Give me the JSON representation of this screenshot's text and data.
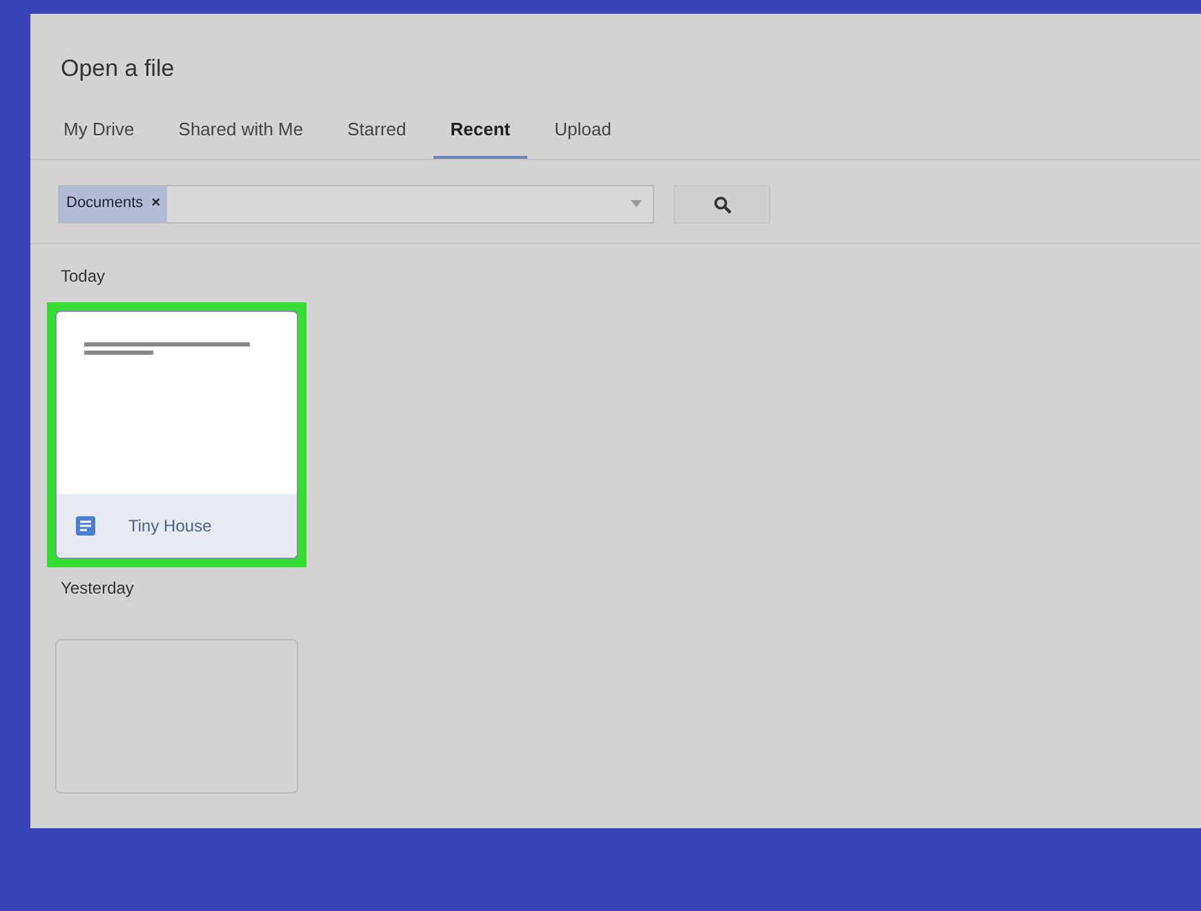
{
  "dialog": {
    "title": "Open a file"
  },
  "tabs": [
    {
      "label": "My Drive",
      "selected": false
    },
    {
      "label": "Shared with Me",
      "selected": false
    },
    {
      "label": "Starred",
      "selected": false
    },
    {
      "label": "Recent",
      "selected": true
    },
    {
      "label": "Upload",
      "selected": false
    }
  ],
  "filter": {
    "chip": "Documents",
    "chip_remove": "×"
  },
  "sections": [
    {
      "heading": "Today",
      "files": [
        {
          "name": "Tiny House",
          "highlighted": true,
          "kind": "document"
        }
      ]
    },
    {
      "heading": "Yesterday",
      "files": [
        {
          "kind": "blank",
          "highlighted": false
        }
      ]
    }
  ]
}
